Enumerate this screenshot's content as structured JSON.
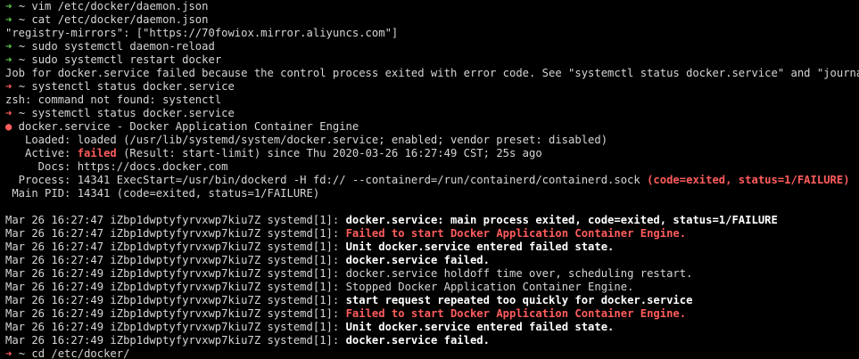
{
  "colors": {
    "background": "#000000",
    "text": "#d6d6d6",
    "prompt_arrow_ok": "#5ec84a",
    "prompt_arrow_err": "#ff5c5c",
    "error": "#ff5c5c"
  },
  "lines": [
    {
      "type": "cmd",
      "status": "ok",
      "arrow": "➜",
      "dir": "~",
      "cmd": "vim /etc/docker/daemon.json"
    },
    {
      "type": "cmd",
      "status": "ok",
      "arrow": "➜",
      "dir": "~",
      "cmd": "cat /etc/docker/daemon.json"
    },
    {
      "type": "out",
      "text": "\"registry-mirrors\": [\"https://70fowiox.mirror.aliyuncs.com\"]"
    },
    {
      "type": "cmd",
      "status": "ok",
      "arrow": "➜",
      "dir": "~",
      "cmd": "sudo systemctl daemon-reload"
    },
    {
      "type": "cmd",
      "status": "ok",
      "arrow": "➜",
      "dir": "~",
      "cmd": "sudo systemctl restart docker"
    },
    {
      "type": "out",
      "text": "Job for docker.service failed because the control process exited with error code. See \"systemctl status docker.service\" and \"journalctl -"
    },
    {
      "type": "cmd",
      "status": "err",
      "arrow": "➜",
      "dir": "~",
      "cmd": "systenctl status docker.service"
    },
    {
      "type": "out",
      "text": "zsh: command not found: systenctl"
    },
    {
      "type": "cmd",
      "status": "err",
      "arrow": "➜",
      "dir": "~",
      "cmd": "systemctl status docker.service"
    },
    {
      "type": "parts",
      "parts": [
        {
          "text": "●",
          "cls": "red"
        },
        {
          "text": " docker.service - Docker Application Container Engine"
        }
      ]
    },
    {
      "type": "out",
      "text": "   Loaded: loaded (/usr/lib/systemd/system/docker.service; enabled; vendor preset: disabled)"
    },
    {
      "type": "parts",
      "parts": [
        {
          "text": "   Active: "
        },
        {
          "text": "failed",
          "cls": "redb"
        },
        {
          "text": " (Result: start-limit) since Thu 2020-03-26 16:27:49 CST; 25s ago"
        }
      ]
    },
    {
      "type": "out",
      "text": "     Docs: https://docs.docker.com"
    },
    {
      "type": "parts",
      "parts": [
        {
          "text": "  Process: 14341 ExecStart=/usr/bin/dockerd -H fd:// --containerd=/run/containerd/containerd.sock "
        },
        {
          "text": "(code=exited, status=1/FAILURE)",
          "cls": "redb"
        }
      ]
    },
    {
      "type": "out",
      "text": " Main PID: 14341 (code=exited, status=1/FAILURE)"
    },
    {
      "type": "blank"
    },
    {
      "type": "log",
      "prefix": "Mar 26 16:27:47 iZbp1dwptyfyrvxwp7kiu7Z systemd[1]: ",
      "msg": "docker.service: main process exited, code=exited, status=1/FAILURE",
      "style": "wb"
    },
    {
      "type": "log",
      "prefix": "Mar 26 16:27:47 iZbp1dwptyfyrvxwp7kiu7Z systemd[1]: ",
      "msg": "Failed to start Docker Application Container Engine.",
      "style": "redb"
    },
    {
      "type": "log",
      "prefix": "Mar 26 16:27:47 iZbp1dwptyfyrvxwp7kiu7Z systemd[1]: ",
      "msg": "Unit docker.service entered failed state.",
      "style": "wb"
    },
    {
      "type": "log",
      "prefix": "Mar 26 16:27:47 iZbp1dwptyfyrvxwp7kiu7Z systemd[1]: ",
      "msg": "docker.service failed.",
      "style": "wb"
    },
    {
      "type": "log",
      "prefix": "Mar 26 16:27:49 iZbp1dwptyfyrvxwp7kiu7Z systemd[1]: ",
      "msg": "docker.service holdoff time over, scheduling restart.",
      "style": ""
    },
    {
      "type": "log",
      "prefix": "Mar 26 16:27:49 iZbp1dwptyfyrvxwp7kiu7Z systemd[1]: ",
      "msg": "Stopped Docker Application Container Engine.",
      "style": ""
    },
    {
      "type": "log",
      "prefix": "Mar 26 16:27:49 iZbp1dwptyfyrvxwp7kiu7Z systemd[1]: ",
      "msg": "start request repeated too quickly for docker.service",
      "style": "wb"
    },
    {
      "type": "log",
      "prefix": "Mar 26 16:27:49 iZbp1dwptyfyrvxwp7kiu7Z systemd[1]: ",
      "msg": "Failed to start Docker Application Container Engine.",
      "style": "redb"
    },
    {
      "type": "log",
      "prefix": "Mar 26 16:27:49 iZbp1dwptyfyrvxwp7kiu7Z systemd[1]: ",
      "msg": "Unit docker.service entered failed state.",
      "style": "wb"
    },
    {
      "type": "log",
      "prefix": "Mar 26 16:27:49 iZbp1dwptyfyrvxwp7kiu7Z systemd[1]: ",
      "msg": "docker.service failed.",
      "style": "wb"
    },
    {
      "type": "cmd",
      "status": "err",
      "arrow": "➜",
      "dir": "~",
      "cmd": "cd /etc/docker/"
    }
  ]
}
